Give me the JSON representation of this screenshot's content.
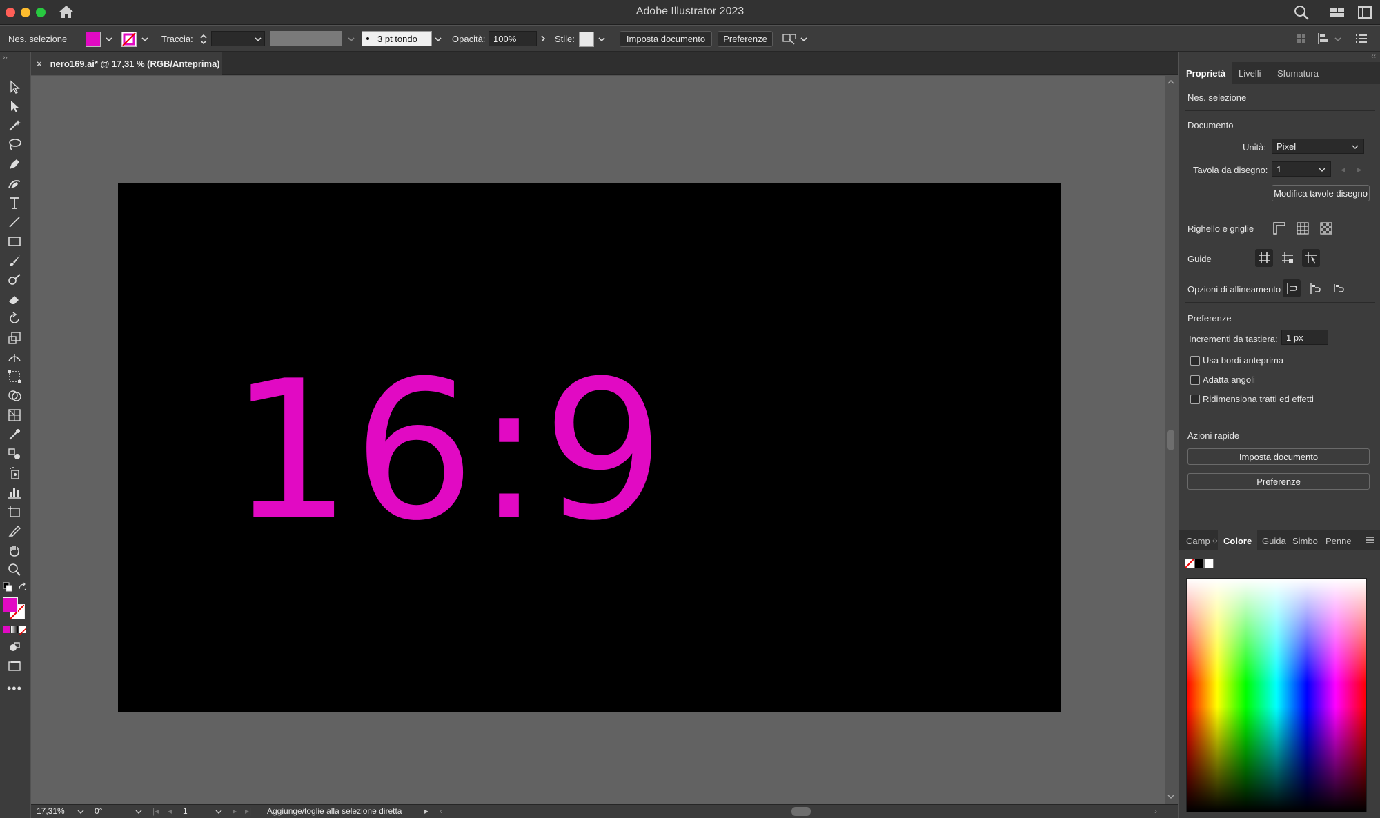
{
  "titlebar": {
    "title": "Adobe Illustrator 2023"
  },
  "controlbar": {
    "selection": "Nes. selezione",
    "stroke_label": "Traccia:",
    "brush": "3 pt tondo",
    "opacity_label": "Opacità:",
    "opacity_value": "100%",
    "style_label": "Stile:",
    "setup_button": "Imposta documento",
    "prefs_button": "Preferenze",
    "fill_color": "#e10ac3"
  },
  "document": {
    "tab_title": "nero169.ai* @ 17,31 % (RGB/Anteprima)",
    "close": "×",
    "artwork_text": "16:9",
    "artwork_color": "#e10ac3",
    "artboard_color": "#000000"
  },
  "statusbar": {
    "zoom": "17,31%",
    "rotation": "0°",
    "artboard": "1",
    "hint": "Aggiunge/toglie alla selezione diretta"
  },
  "panel": {
    "tabs": [
      "Proprietà",
      "Livelli",
      "Sfumatura"
    ],
    "selection": "Nes. selezione",
    "document_heading": "Documento",
    "units_label": "Unità:",
    "units_value": "Pixel",
    "artboard_label": "Tavola da disegno:",
    "artboard_value": "1",
    "edit_artboards": "Modifica tavole disegno",
    "rulers_label": "Righello e griglie",
    "guides_label": "Guide",
    "snap_label": "Opzioni di allineamento",
    "prefs_heading": "Preferenze",
    "keyboard_inc_label": "Incrementi da tastiera:",
    "keyboard_inc_value": "1 px",
    "cb_preview_bounds": "Usa bordi anteprima",
    "cb_scale_corners": "Adatta angoli",
    "cb_scale_strokes": "Ridimensiona tratti ed effetti",
    "quick_actions": "Azioni rapide",
    "qa_setup": "Imposta documento",
    "qa_prefs": "Preferenze"
  },
  "color_panel": {
    "tabs": [
      "Camp",
      "Colore",
      "Guida",
      "Simbo",
      "Penne"
    ]
  }
}
